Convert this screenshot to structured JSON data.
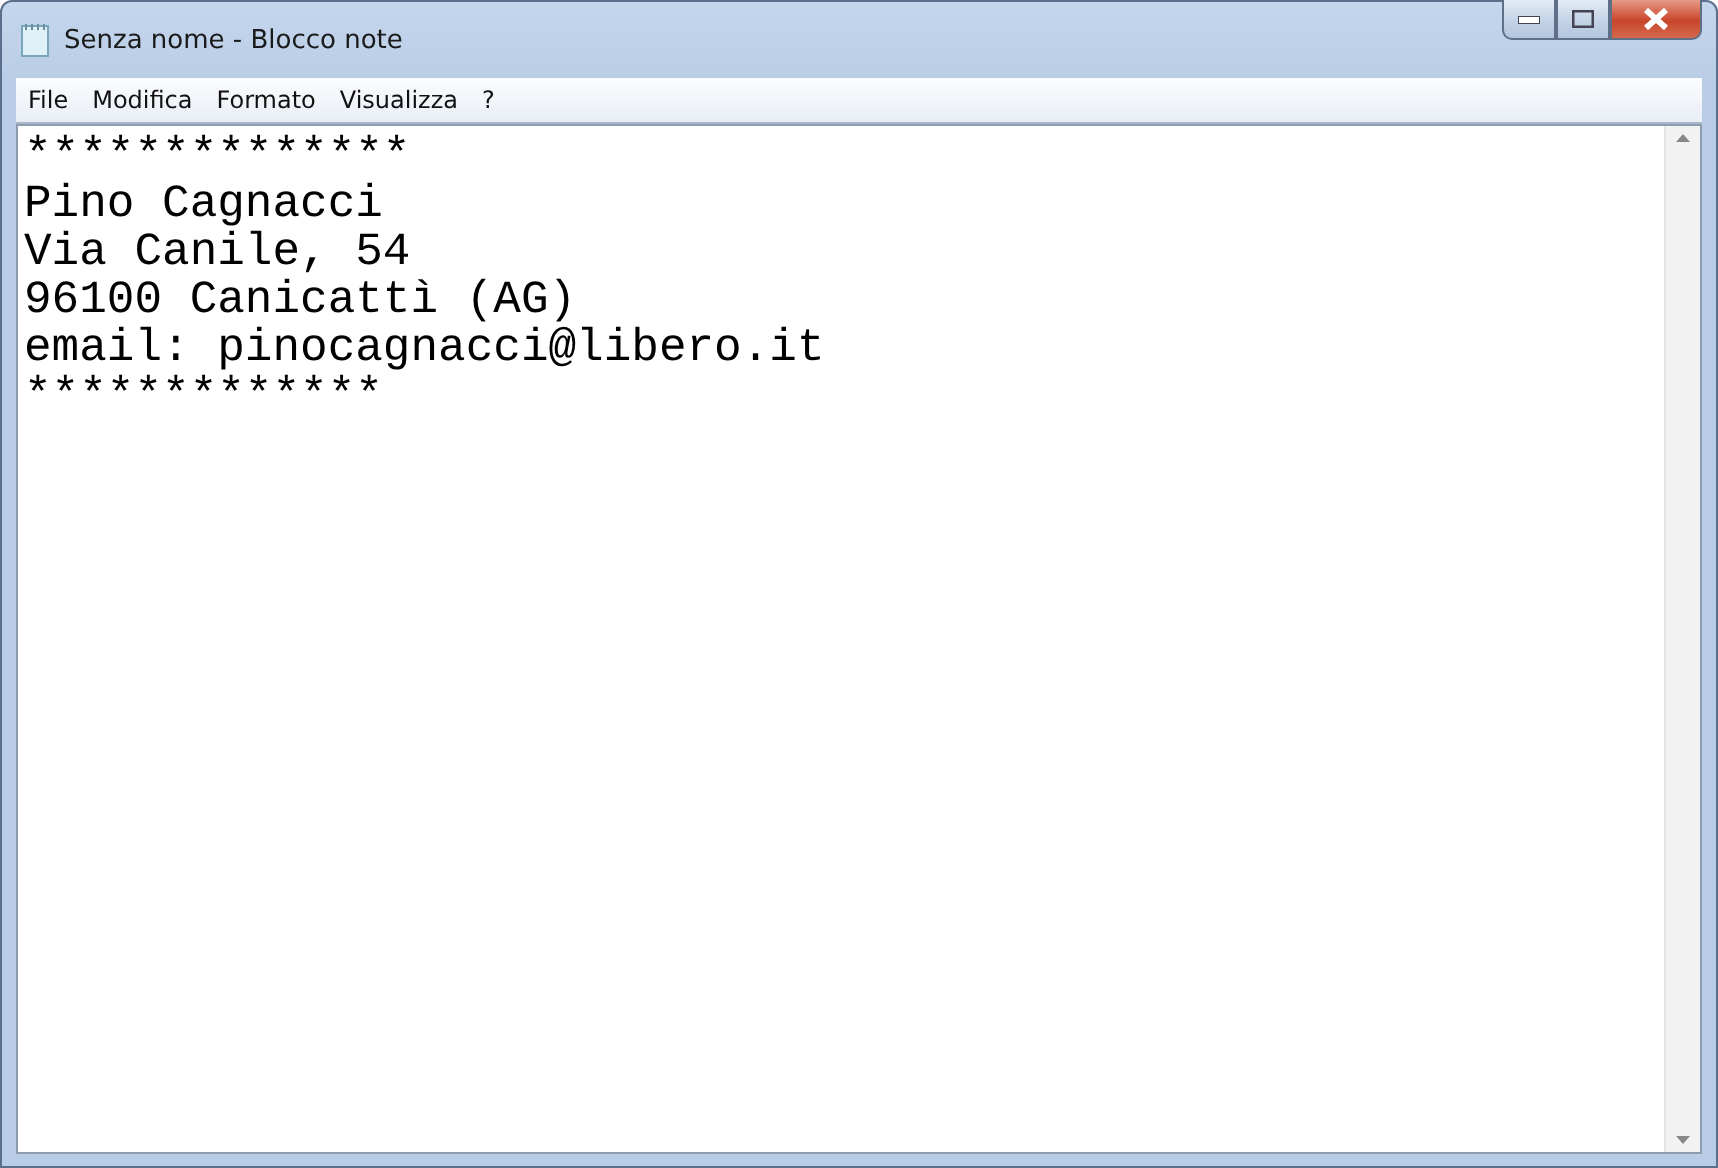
{
  "window": {
    "title": "Senza nome - Blocco note"
  },
  "menu": [
    "File",
    "Modifica",
    "Formato",
    "Visualizza",
    "?"
  ],
  "document": {
    "lines": [
      "**************",
      "Pino Cagnacci",
      "Via Canile, 54",
      "96100 Canicattì (AG)",
      "email: pinocagnacci@libero.it",
      "*************"
    ]
  }
}
